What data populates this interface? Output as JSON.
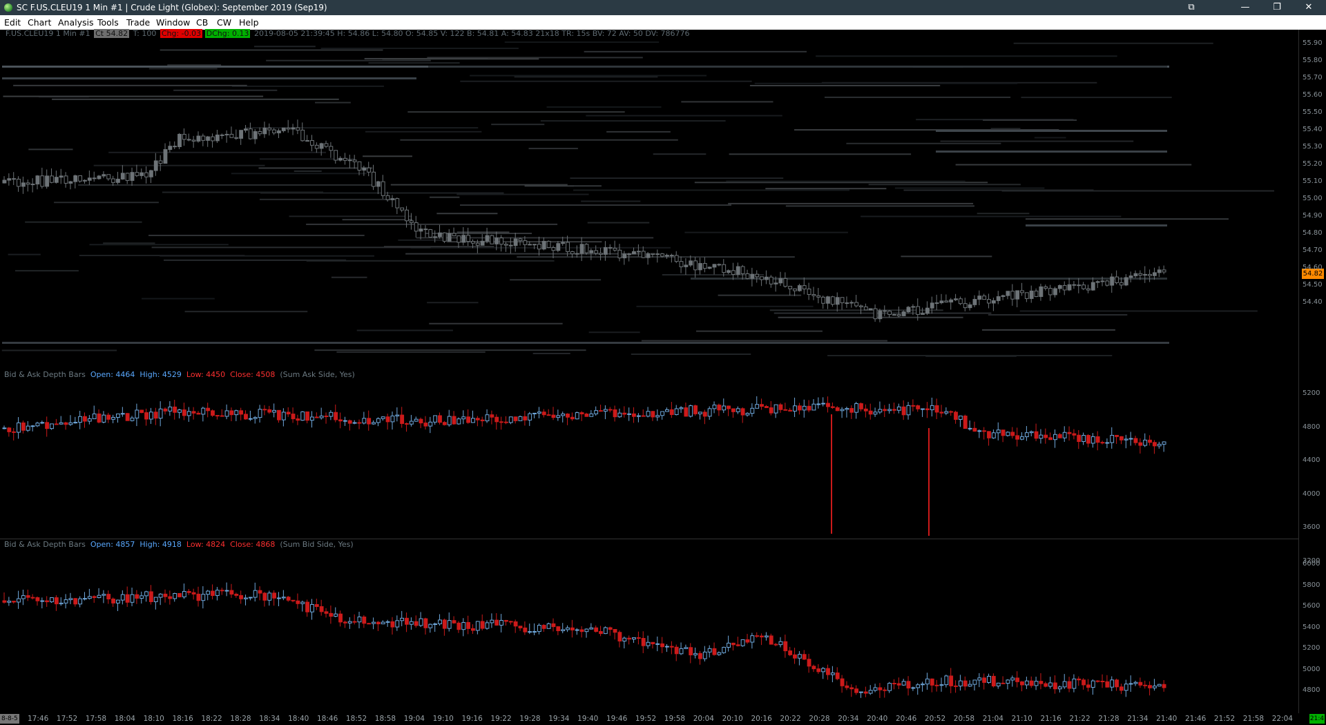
{
  "window": {
    "title": "SC F.US.CLEU19  1 Min  #1 | Crude Light (Globex): September 2019 (Sep19)",
    "minimize_glyph": "—",
    "maximize_glyph": "❐",
    "close_glyph": "✕",
    "extra_glyph": "⧉"
  },
  "menu": [
    "Edit",
    "Chart",
    "Analysis",
    "Tools",
    "Trade",
    "Window",
    "CB",
    "CW",
    "Help"
  ],
  "chart_header": {
    "symbol": "F.US.CLEU19  1 Min  #1",
    "last_label": "Ct 54.82",
    "ticks": "T: 100",
    "chg": "Chg: -0.03",
    "dchg": "DChg: 0.13",
    "details": "2019-08-05 21:39:45 H: 54.86 L: 54.80 O: 54.85 V: 122 B: 54.81 A: 54.83 21x18 TR: 15s BV: 72 AV: 50 DV: 786776"
  },
  "price_tag": "54.82",
  "price_axis": [
    "55.90",
    "55.80",
    "55.70",
    "55.60",
    "55.50",
    "55.40",
    "55.30",
    "55.20",
    "55.10",
    "55.00",
    "54.90",
    "54.80",
    "54.70",
    "54.60",
    "54.50",
    "54.40"
  ],
  "study1": {
    "name": "Bid & Ask Depth Bars",
    "open": "Open: 4464",
    "high": "High: 4529",
    "low": "Low: 4450",
    "close": "Close: 4508",
    "params": "(Sum Ask Side, Yes)",
    "axis": [
      "5200",
      "4800",
      "4400",
      "4000",
      "3600",
      "3200"
    ]
  },
  "study2": {
    "name": "Bid & Ask Depth Bars",
    "open": "Open: 4857",
    "high": "High: 4918",
    "low": "Low: 4824",
    "close": "Close: 4868",
    "params": "(Sum Bid Side, Yes)",
    "axis": [
      "6000",
      "5800",
      "5600",
      "5400",
      "5200",
      "5000",
      "4800"
    ]
  },
  "time_axis": [
    "17:46",
    "17:52",
    "17:58",
    "18:04",
    "18:10",
    "18:16",
    "18:22",
    "18:28",
    "18:34",
    "18:40",
    "18:46",
    "18:52",
    "18:58",
    "19:04",
    "19:10",
    "19:16",
    "19:22",
    "19:28",
    "19:34",
    "19:40",
    "19:46",
    "19:52",
    "19:58",
    "20:04",
    "20:10",
    "20:16",
    "20:22",
    "20:28",
    "20:34",
    "20:40",
    "20:46",
    "20:52",
    "20:58",
    "21:04",
    "21:10",
    "21:16",
    "21:22",
    "21:28",
    "21:34",
    "21:40",
    "21:46",
    "21:52",
    "21:58",
    "22:04"
  ],
  "corner_left": "8-8-5",
  "corner_right": "21:4",
  "colors": {
    "up": "#6fa8dc",
    "down": "#cc1a1a",
    "price_candle": "#7a7f83",
    "accent": "#ff8a00"
  }
}
